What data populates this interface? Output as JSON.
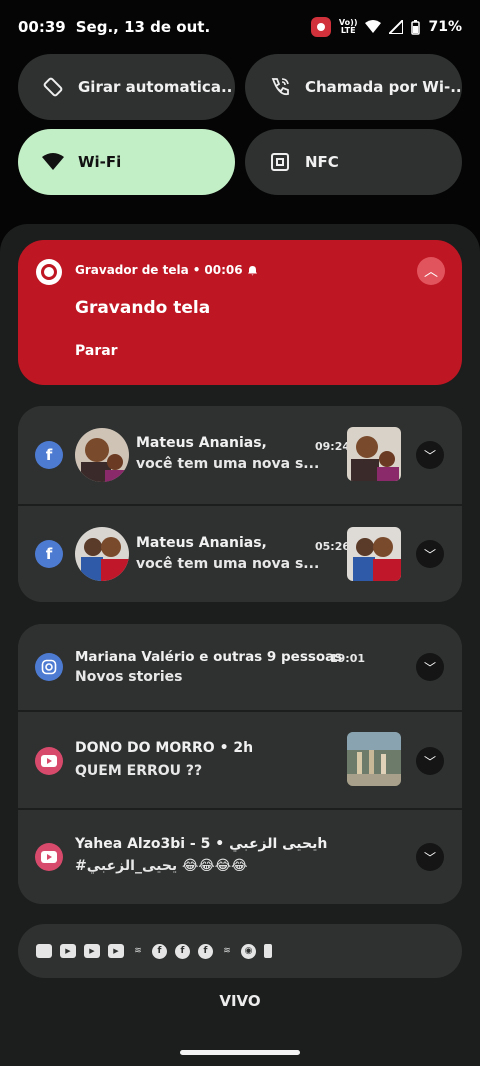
{
  "status_bar": {
    "time": "00:39",
    "date": "Seg., 13 de out.",
    "battery": "71%",
    "volte_top": "Vo))",
    "volte_bottom": "LTE"
  },
  "quick_settings": [
    {
      "label": "Girar automatica..",
      "icon": "rotate-icon",
      "active": false
    },
    {
      "label": "Chamada por Wi-..",
      "icon": "wifi-call-icon",
      "active": false
    },
    {
      "label": "Wi-Fi",
      "icon": "wifi-icon",
      "active": true
    },
    {
      "label": "NFC",
      "icon": "nfc-icon",
      "active": false
    }
  ],
  "recorder": {
    "app": "Gravador de tela",
    "elapsed": "00:06",
    "title": "Gravando tela",
    "action": "Parar",
    "color": "#be1622"
  },
  "facebook": [
    {
      "title": "Mateus Ananias,",
      "body": "você tem uma nova s...",
      "time": "09:24"
    },
    {
      "title": "Mateus Ananias,",
      "body": "você tem uma nova s...",
      "time": "05:26"
    }
  ],
  "instagram": {
    "title": "Mariana Valério e outras 9 pessoas",
    "time": "19:01",
    "body": "Novos stories"
  },
  "youtube": [
    {
      "title": "DONO DO MORRO",
      "time": "2h",
      "body": "QUEM ERROU ??"
    },
    {
      "title": "Yahea Alzo3bi - يحيى الزعبي",
      "time": "5h",
      "body": "#يحيى_الزعبي 😂😂😂😂"
    }
  ],
  "carrier": "VIVO"
}
